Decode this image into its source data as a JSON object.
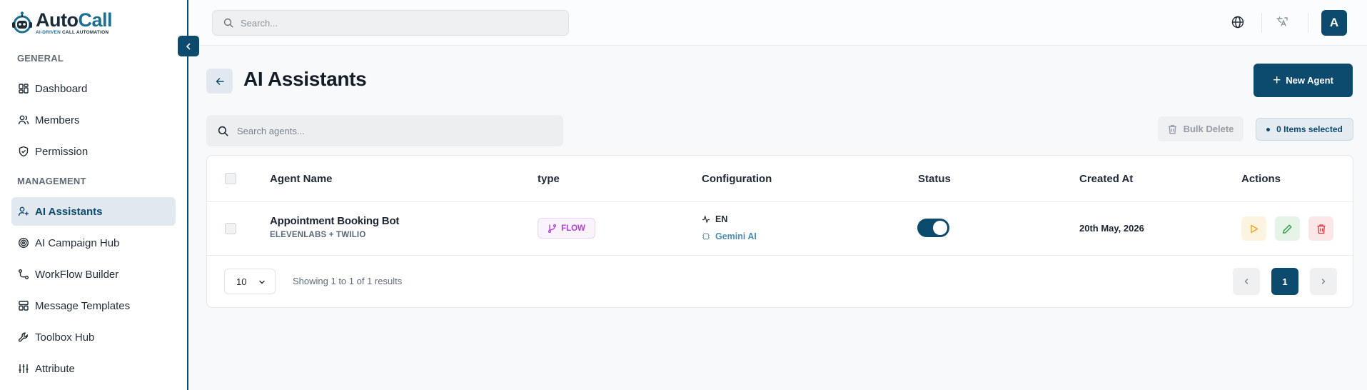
{
  "brand": {
    "name_part1": "Auto",
    "name_part2": "Call",
    "tagline_part1": "AI-DRIVEN",
    "tagline_part2": " CALL AUTOMATION",
    "accent": "#0d4b6e"
  },
  "topbar": {
    "search_placeholder": "Search...",
    "avatar_initial": "A"
  },
  "sidebar": {
    "section_general": "GENERAL",
    "section_management": "MANAGEMENT",
    "items": [
      {
        "label": "Dashboard",
        "icon": "dashboard-icon"
      },
      {
        "label": "Members",
        "icon": "users-icon"
      },
      {
        "label": "Permission",
        "icon": "shield-icon"
      },
      {
        "label": "AI Assistants",
        "icon": "user-plus-icon",
        "active": true
      },
      {
        "label": "AI Campaign Hub",
        "icon": "target-icon"
      },
      {
        "label": "WorkFlow Builder",
        "icon": "workflow-icon"
      },
      {
        "label": "Message Templates",
        "icon": "template-icon"
      },
      {
        "label": "Toolbox Hub",
        "icon": "wrench-icon"
      },
      {
        "label": "Attribute",
        "icon": "sliders-icon"
      }
    ]
  },
  "main": {
    "title": "AI Assistants",
    "new_agent_label": "New Agent",
    "search_placeholder": "Search agents...",
    "bulk_delete_label": "Bulk Delete",
    "selected_label": "0 Items selected"
  },
  "table": {
    "columns": [
      "Agent Name",
      "type",
      "Configuration",
      "Status",
      "Created At",
      "Actions"
    ],
    "rows": [
      {
        "name": "Appointment Booking Bot",
        "sub": "ELEVENLABS + TWILIO",
        "type": "FLOW",
        "language": "EN",
        "model": "Gemini AI",
        "status_on": true,
        "created": "20th May, 2026"
      }
    ]
  },
  "pagination": {
    "per_page": "10",
    "showing": "Showing 1 to 1 of 1 results",
    "current_page": "1"
  }
}
